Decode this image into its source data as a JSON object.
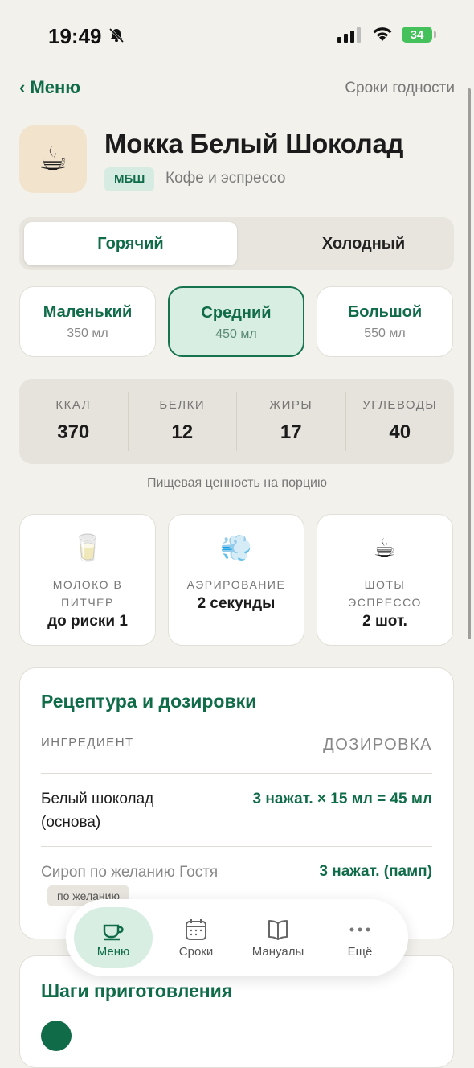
{
  "status_bar": {
    "time": "19:49",
    "battery": "34",
    "icons": [
      "bell-slash-icon",
      "signal-icon",
      "wifi-icon",
      "battery-icon"
    ]
  },
  "nav": {
    "back_label": "‹ Меню",
    "right_label": "Сроки годности"
  },
  "product": {
    "icon": "☕",
    "title": "Мокка Белый Шоколад",
    "code": "МБШ",
    "category": "Кофе и эспрессо"
  },
  "temperature": {
    "options": [
      "Горячий",
      "Холодный"
    ],
    "selected": "Горячий"
  },
  "sizes": [
    {
      "name": "Маленький",
      "volume": "350 мл"
    },
    {
      "name": "Средний",
      "volume": "450 мл"
    },
    {
      "name": "Большой",
      "volume": "550 мл"
    }
  ],
  "selected_size": "Средний",
  "nutrition": {
    "items": [
      {
        "label": "ККАЛ",
        "value": "370"
      },
      {
        "label": "БЕЛКИ",
        "value": "12"
      },
      {
        "label": "ЖИРЫ",
        "value": "17"
      },
      {
        "label": "УГЛЕВОДЫ",
        "value": "40"
      }
    ],
    "note": "Пищевая ценность на порцию"
  },
  "prep": [
    {
      "icon": "🥛",
      "label_line1": "МОЛОКО В",
      "label_line2": "ПИТЧЕР",
      "value": "до риски 1"
    },
    {
      "icon": "💨",
      "label_line1": "АЭРИРОВАНИЕ",
      "label_line2": "",
      "value": "2 секунды"
    },
    {
      "icon": "☕",
      "label_line1": "ШОТЫ",
      "label_line2": "ЭСПРЕССО",
      "value": "2 шот."
    }
  ],
  "recipe": {
    "title": "Рецептура и дозировки",
    "header_ingredient": "ИНГРЕДИЕНТ",
    "header_dose": "ДОЗИРОВКА",
    "rows": [
      {
        "name_line1": "Белый шоколад",
        "name_line2": "(основа)",
        "dose": "3 нажат. × 15 мл = 45 мл"
      },
      {
        "name_line1": "Сироп по желанию Гостя",
        "name_line2": "",
        "dose": "3 нажат. (памп)",
        "badge": "по желанию"
      }
    ]
  },
  "steps": {
    "title": "Шаги приготовления"
  },
  "tabbar": {
    "tabs": [
      {
        "label": "Меню",
        "icon": "coffee-cup-icon"
      },
      {
        "label": "Сроки",
        "icon": "calendar-icon"
      },
      {
        "label": "Мануалы",
        "icon": "book-icon"
      },
      {
        "label": "Ещё",
        "icon": "more-dots-icon"
      }
    ],
    "active": "Меню"
  },
  "colors": {
    "accent": "#0f6b48",
    "accent_light": "#d8eee3",
    "background": "#f2f1ec",
    "card": "#ffffff",
    "muted": "#e5e3db"
  }
}
